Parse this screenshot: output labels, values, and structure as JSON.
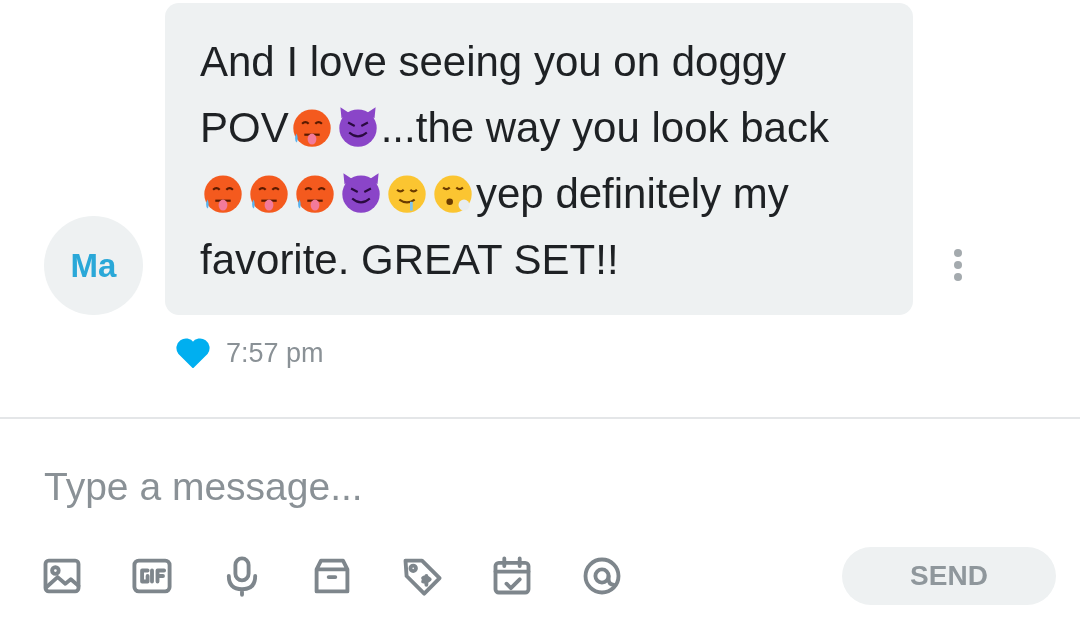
{
  "message": {
    "avatar_initials": "Ma",
    "parts": [
      {
        "kind": "text",
        "text": "And I love seeing you on doggy POV"
      },
      {
        "kind": "hot-face"
      },
      {
        "kind": "devil-face"
      },
      {
        "kind": "text",
        "text": "...the way you look back "
      },
      {
        "kind": "hot-face"
      },
      {
        "kind": "hot-face"
      },
      {
        "kind": "hot-face"
      },
      {
        "kind": "devil-face"
      },
      {
        "kind": "drooling-face"
      },
      {
        "kind": "exhale-face"
      },
      {
        "kind": "text",
        "text": "yep definitely my favorite. GREAT SET!!"
      }
    ],
    "liked": true,
    "time": "7:57 pm"
  },
  "composer": {
    "placeholder": "Type a message...",
    "tools": [
      {
        "kind": "image"
      },
      {
        "kind": "gif"
      },
      {
        "kind": "mic"
      },
      {
        "kind": "box"
      },
      {
        "kind": "tag"
      },
      {
        "kind": "calendar"
      },
      {
        "kind": "at"
      }
    ],
    "send_label": "SEND",
    "send_disabled": true
  }
}
